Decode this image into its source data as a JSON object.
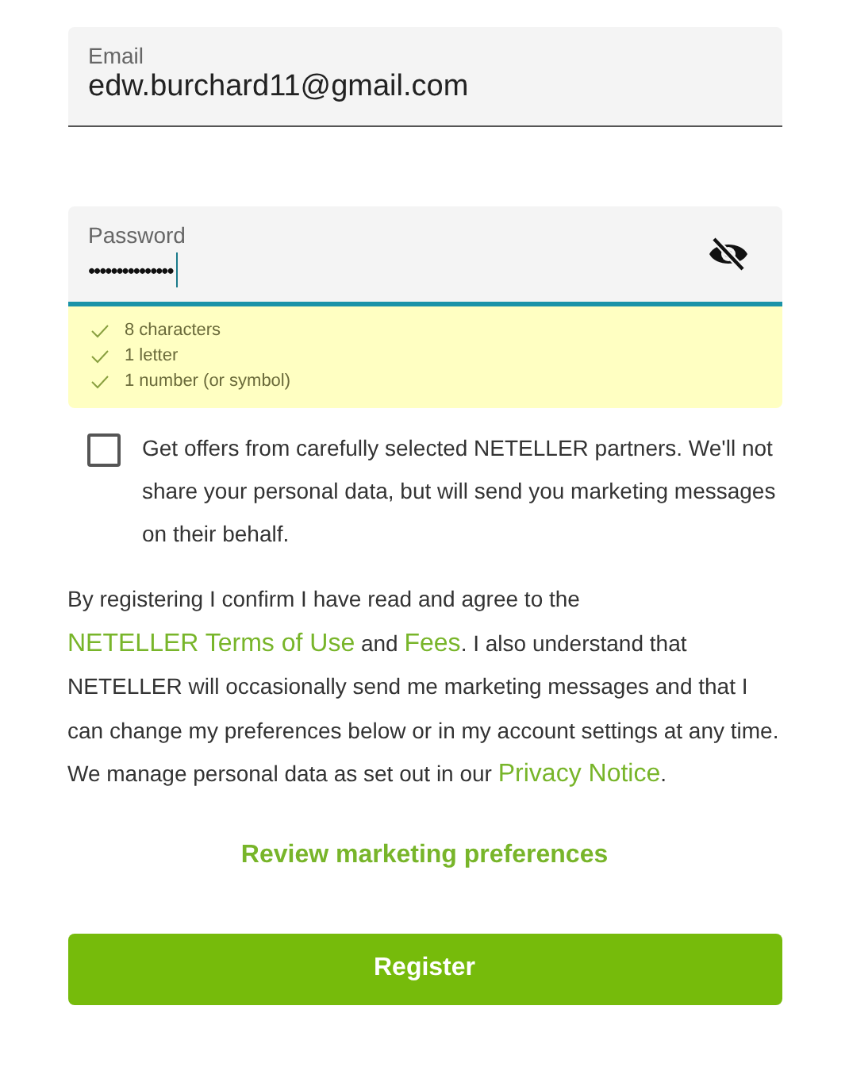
{
  "email": {
    "label": "Email",
    "value": "edw.burchard11@gmail.com"
  },
  "password": {
    "label": "Password",
    "value": "•••••••••••••••",
    "visible": false,
    "focused": true,
    "rules": [
      {
        "text": "8 characters",
        "met": true
      },
      {
        "text": "1 letter",
        "met": true
      },
      {
        "text": "1 number (or symbol)",
        "met": true
      }
    ]
  },
  "offers": {
    "text": "Get offers from carefully selected NETELLER partners. We'll not share your personal data, but will send you marketing messages on their behalf.",
    "checked": false
  },
  "consent": [
    {
      "kind": "text",
      "text": "By registering I confirm I have read and agree to the "
    },
    {
      "kind": "link",
      "text": "NETELLER Terms of Use"
    },
    {
      "kind": "text",
      "text": " and "
    },
    {
      "kind": "link",
      "text": "Fees"
    },
    {
      "kind": "text",
      "text": ". I also understand that NETELLER will occasionally send me marketing messages and that I can change my preferences below or in my account settings at any time. We manage personal data as set out in our "
    },
    {
      "kind": "link",
      "text": "Privacy Notice"
    },
    {
      "kind": "text",
      "text": "."
    }
  ],
  "preferences_link": "Review marketing preferences",
  "register_button": "Register"
}
